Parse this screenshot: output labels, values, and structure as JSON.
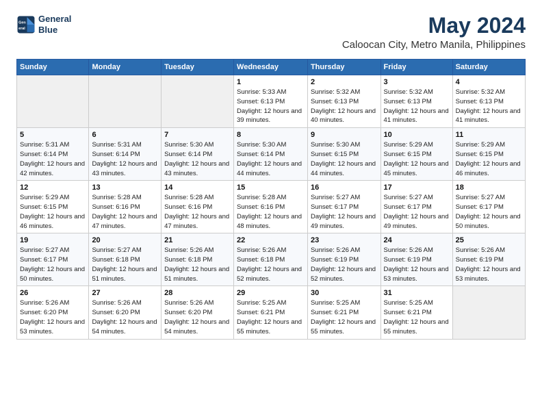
{
  "logo": {
    "line1": "General",
    "line2": "Blue"
  },
  "header": {
    "month_year": "May 2024",
    "location": "Caloocan City, Metro Manila, Philippines"
  },
  "weekdays": [
    "Sunday",
    "Monday",
    "Tuesday",
    "Wednesday",
    "Thursday",
    "Friday",
    "Saturday"
  ],
  "weeks": [
    [
      {
        "day": "",
        "sunrise": "",
        "sunset": "",
        "daylight": ""
      },
      {
        "day": "",
        "sunrise": "",
        "sunset": "",
        "daylight": ""
      },
      {
        "day": "",
        "sunrise": "",
        "sunset": "",
        "daylight": ""
      },
      {
        "day": "1",
        "sunrise": "Sunrise: 5:33 AM",
        "sunset": "Sunset: 6:13 PM",
        "daylight": "Daylight: 12 hours and 39 minutes."
      },
      {
        "day": "2",
        "sunrise": "Sunrise: 5:32 AM",
        "sunset": "Sunset: 6:13 PM",
        "daylight": "Daylight: 12 hours and 40 minutes."
      },
      {
        "day": "3",
        "sunrise": "Sunrise: 5:32 AM",
        "sunset": "Sunset: 6:13 PM",
        "daylight": "Daylight: 12 hours and 41 minutes."
      },
      {
        "day": "4",
        "sunrise": "Sunrise: 5:32 AM",
        "sunset": "Sunset: 6:13 PM",
        "daylight": "Daylight: 12 hours and 41 minutes."
      }
    ],
    [
      {
        "day": "5",
        "sunrise": "Sunrise: 5:31 AM",
        "sunset": "Sunset: 6:14 PM",
        "daylight": "Daylight: 12 hours and 42 minutes."
      },
      {
        "day": "6",
        "sunrise": "Sunrise: 5:31 AM",
        "sunset": "Sunset: 6:14 PM",
        "daylight": "Daylight: 12 hours and 43 minutes."
      },
      {
        "day": "7",
        "sunrise": "Sunrise: 5:30 AM",
        "sunset": "Sunset: 6:14 PM",
        "daylight": "Daylight: 12 hours and 43 minutes."
      },
      {
        "day": "8",
        "sunrise": "Sunrise: 5:30 AM",
        "sunset": "Sunset: 6:14 PM",
        "daylight": "Daylight: 12 hours and 44 minutes."
      },
      {
        "day": "9",
        "sunrise": "Sunrise: 5:30 AM",
        "sunset": "Sunset: 6:15 PM",
        "daylight": "Daylight: 12 hours and 44 minutes."
      },
      {
        "day": "10",
        "sunrise": "Sunrise: 5:29 AM",
        "sunset": "Sunset: 6:15 PM",
        "daylight": "Daylight: 12 hours and 45 minutes."
      },
      {
        "day": "11",
        "sunrise": "Sunrise: 5:29 AM",
        "sunset": "Sunset: 6:15 PM",
        "daylight": "Daylight: 12 hours and 46 minutes."
      }
    ],
    [
      {
        "day": "12",
        "sunrise": "Sunrise: 5:29 AM",
        "sunset": "Sunset: 6:15 PM",
        "daylight": "Daylight: 12 hours and 46 minutes."
      },
      {
        "day": "13",
        "sunrise": "Sunrise: 5:28 AM",
        "sunset": "Sunset: 6:16 PM",
        "daylight": "Daylight: 12 hours and 47 minutes."
      },
      {
        "day": "14",
        "sunrise": "Sunrise: 5:28 AM",
        "sunset": "Sunset: 6:16 PM",
        "daylight": "Daylight: 12 hours and 47 minutes."
      },
      {
        "day": "15",
        "sunrise": "Sunrise: 5:28 AM",
        "sunset": "Sunset: 6:16 PM",
        "daylight": "Daylight: 12 hours and 48 minutes."
      },
      {
        "day": "16",
        "sunrise": "Sunrise: 5:27 AM",
        "sunset": "Sunset: 6:17 PM",
        "daylight": "Daylight: 12 hours and 49 minutes."
      },
      {
        "day": "17",
        "sunrise": "Sunrise: 5:27 AM",
        "sunset": "Sunset: 6:17 PM",
        "daylight": "Daylight: 12 hours and 49 minutes."
      },
      {
        "day": "18",
        "sunrise": "Sunrise: 5:27 AM",
        "sunset": "Sunset: 6:17 PM",
        "daylight": "Daylight: 12 hours and 50 minutes."
      }
    ],
    [
      {
        "day": "19",
        "sunrise": "Sunrise: 5:27 AM",
        "sunset": "Sunset: 6:17 PM",
        "daylight": "Daylight: 12 hours and 50 minutes."
      },
      {
        "day": "20",
        "sunrise": "Sunrise: 5:27 AM",
        "sunset": "Sunset: 6:18 PM",
        "daylight": "Daylight: 12 hours and 51 minutes."
      },
      {
        "day": "21",
        "sunrise": "Sunrise: 5:26 AM",
        "sunset": "Sunset: 6:18 PM",
        "daylight": "Daylight: 12 hours and 51 minutes."
      },
      {
        "day": "22",
        "sunrise": "Sunrise: 5:26 AM",
        "sunset": "Sunset: 6:18 PM",
        "daylight": "Daylight: 12 hours and 52 minutes."
      },
      {
        "day": "23",
        "sunrise": "Sunrise: 5:26 AM",
        "sunset": "Sunset: 6:19 PM",
        "daylight": "Daylight: 12 hours and 52 minutes."
      },
      {
        "day": "24",
        "sunrise": "Sunrise: 5:26 AM",
        "sunset": "Sunset: 6:19 PM",
        "daylight": "Daylight: 12 hours and 53 minutes."
      },
      {
        "day": "25",
        "sunrise": "Sunrise: 5:26 AM",
        "sunset": "Sunset: 6:19 PM",
        "daylight": "Daylight: 12 hours and 53 minutes."
      }
    ],
    [
      {
        "day": "26",
        "sunrise": "Sunrise: 5:26 AM",
        "sunset": "Sunset: 6:20 PM",
        "daylight": "Daylight: 12 hours and 53 minutes."
      },
      {
        "day": "27",
        "sunrise": "Sunrise: 5:26 AM",
        "sunset": "Sunset: 6:20 PM",
        "daylight": "Daylight: 12 hours and 54 minutes."
      },
      {
        "day": "28",
        "sunrise": "Sunrise: 5:26 AM",
        "sunset": "Sunset: 6:20 PM",
        "daylight": "Daylight: 12 hours and 54 minutes."
      },
      {
        "day": "29",
        "sunrise": "Sunrise: 5:25 AM",
        "sunset": "Sunset: 6:21 PM",
        "daylight": "Daylight: 12 hours and 55 minutes."
      },
      {
        "day": "30",
        "sunrise": "Sunrise: 5:25 AM",
        "sunset": "Sunset: 6:21 PM",
        "daylight": "Daylight: 12 hours and 55 minutes."
      },
      {
        "day": "31",
        "sunrise": "Sunrise: 5:25 AM",
        "sunset": "Sunset: 6:21 PM",
        "daylight": "Daylight: 12 hours and 55 minutes."
      },
      {
        "day": "",
        "sunrise": "",
        "sunset": "",
        "daylight": ""
      }
    ]
  ]
}
